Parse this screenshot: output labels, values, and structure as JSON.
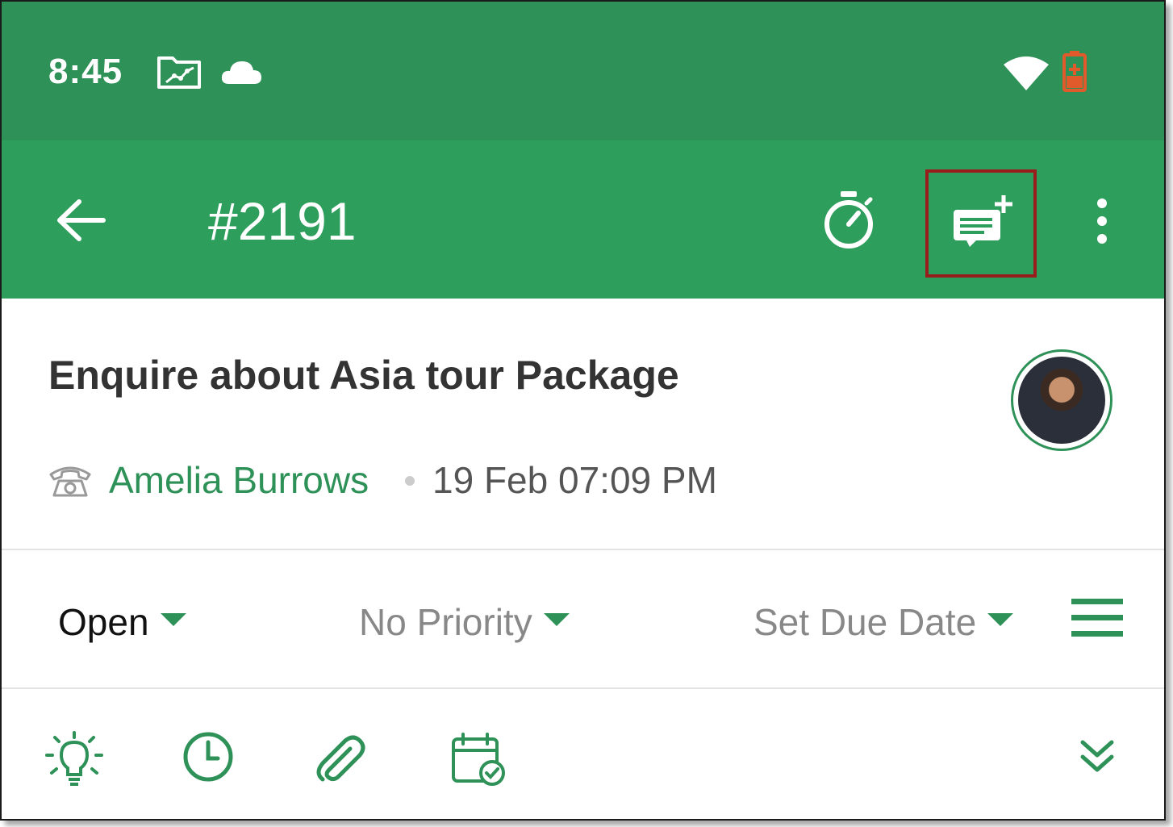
{
  "status_bar": {
    "time": "8:45",
    "icons": [
      "folder-chart-icon",
      "cloud-icon",
      "wifi-icon",
      "battery-icon"
    ]
  },
  "app_bar": {
    "ticket_id": "#2191",
    "actions": [
      "back-arrow-icon",
      "stopwatch-icon",
      "add-note-icon",
      "more-vert-icon"
    ]
  },
  "ticket": {
    "subject": "Enquire about Asia tour Package",
    "contact_name": "Amelia Burrows",
    "created": "19 Feb 07:09 PM",
    "channel_icon": "phone-icon"
  },
  "properties": {
    "status": "Open",
    "priority": "No Priority",
    "due_date": "Set Due Date"
  },
  "toolbar": {
    "icons": [
      "lightbulb-icon",
      "clock-icon",
      "paperclip-icon",
      "calendar-check-icon",
      "chevron-double-down-icon"
    ]
  },
  "colors": {
    "status_bar": "#2e9157",
    "app_bar": "#2e9e5c",
    "accent": "#2e9157",
    "highlight": "#9a1d1d",
    "battery": "#e05a2b"
  }
}
